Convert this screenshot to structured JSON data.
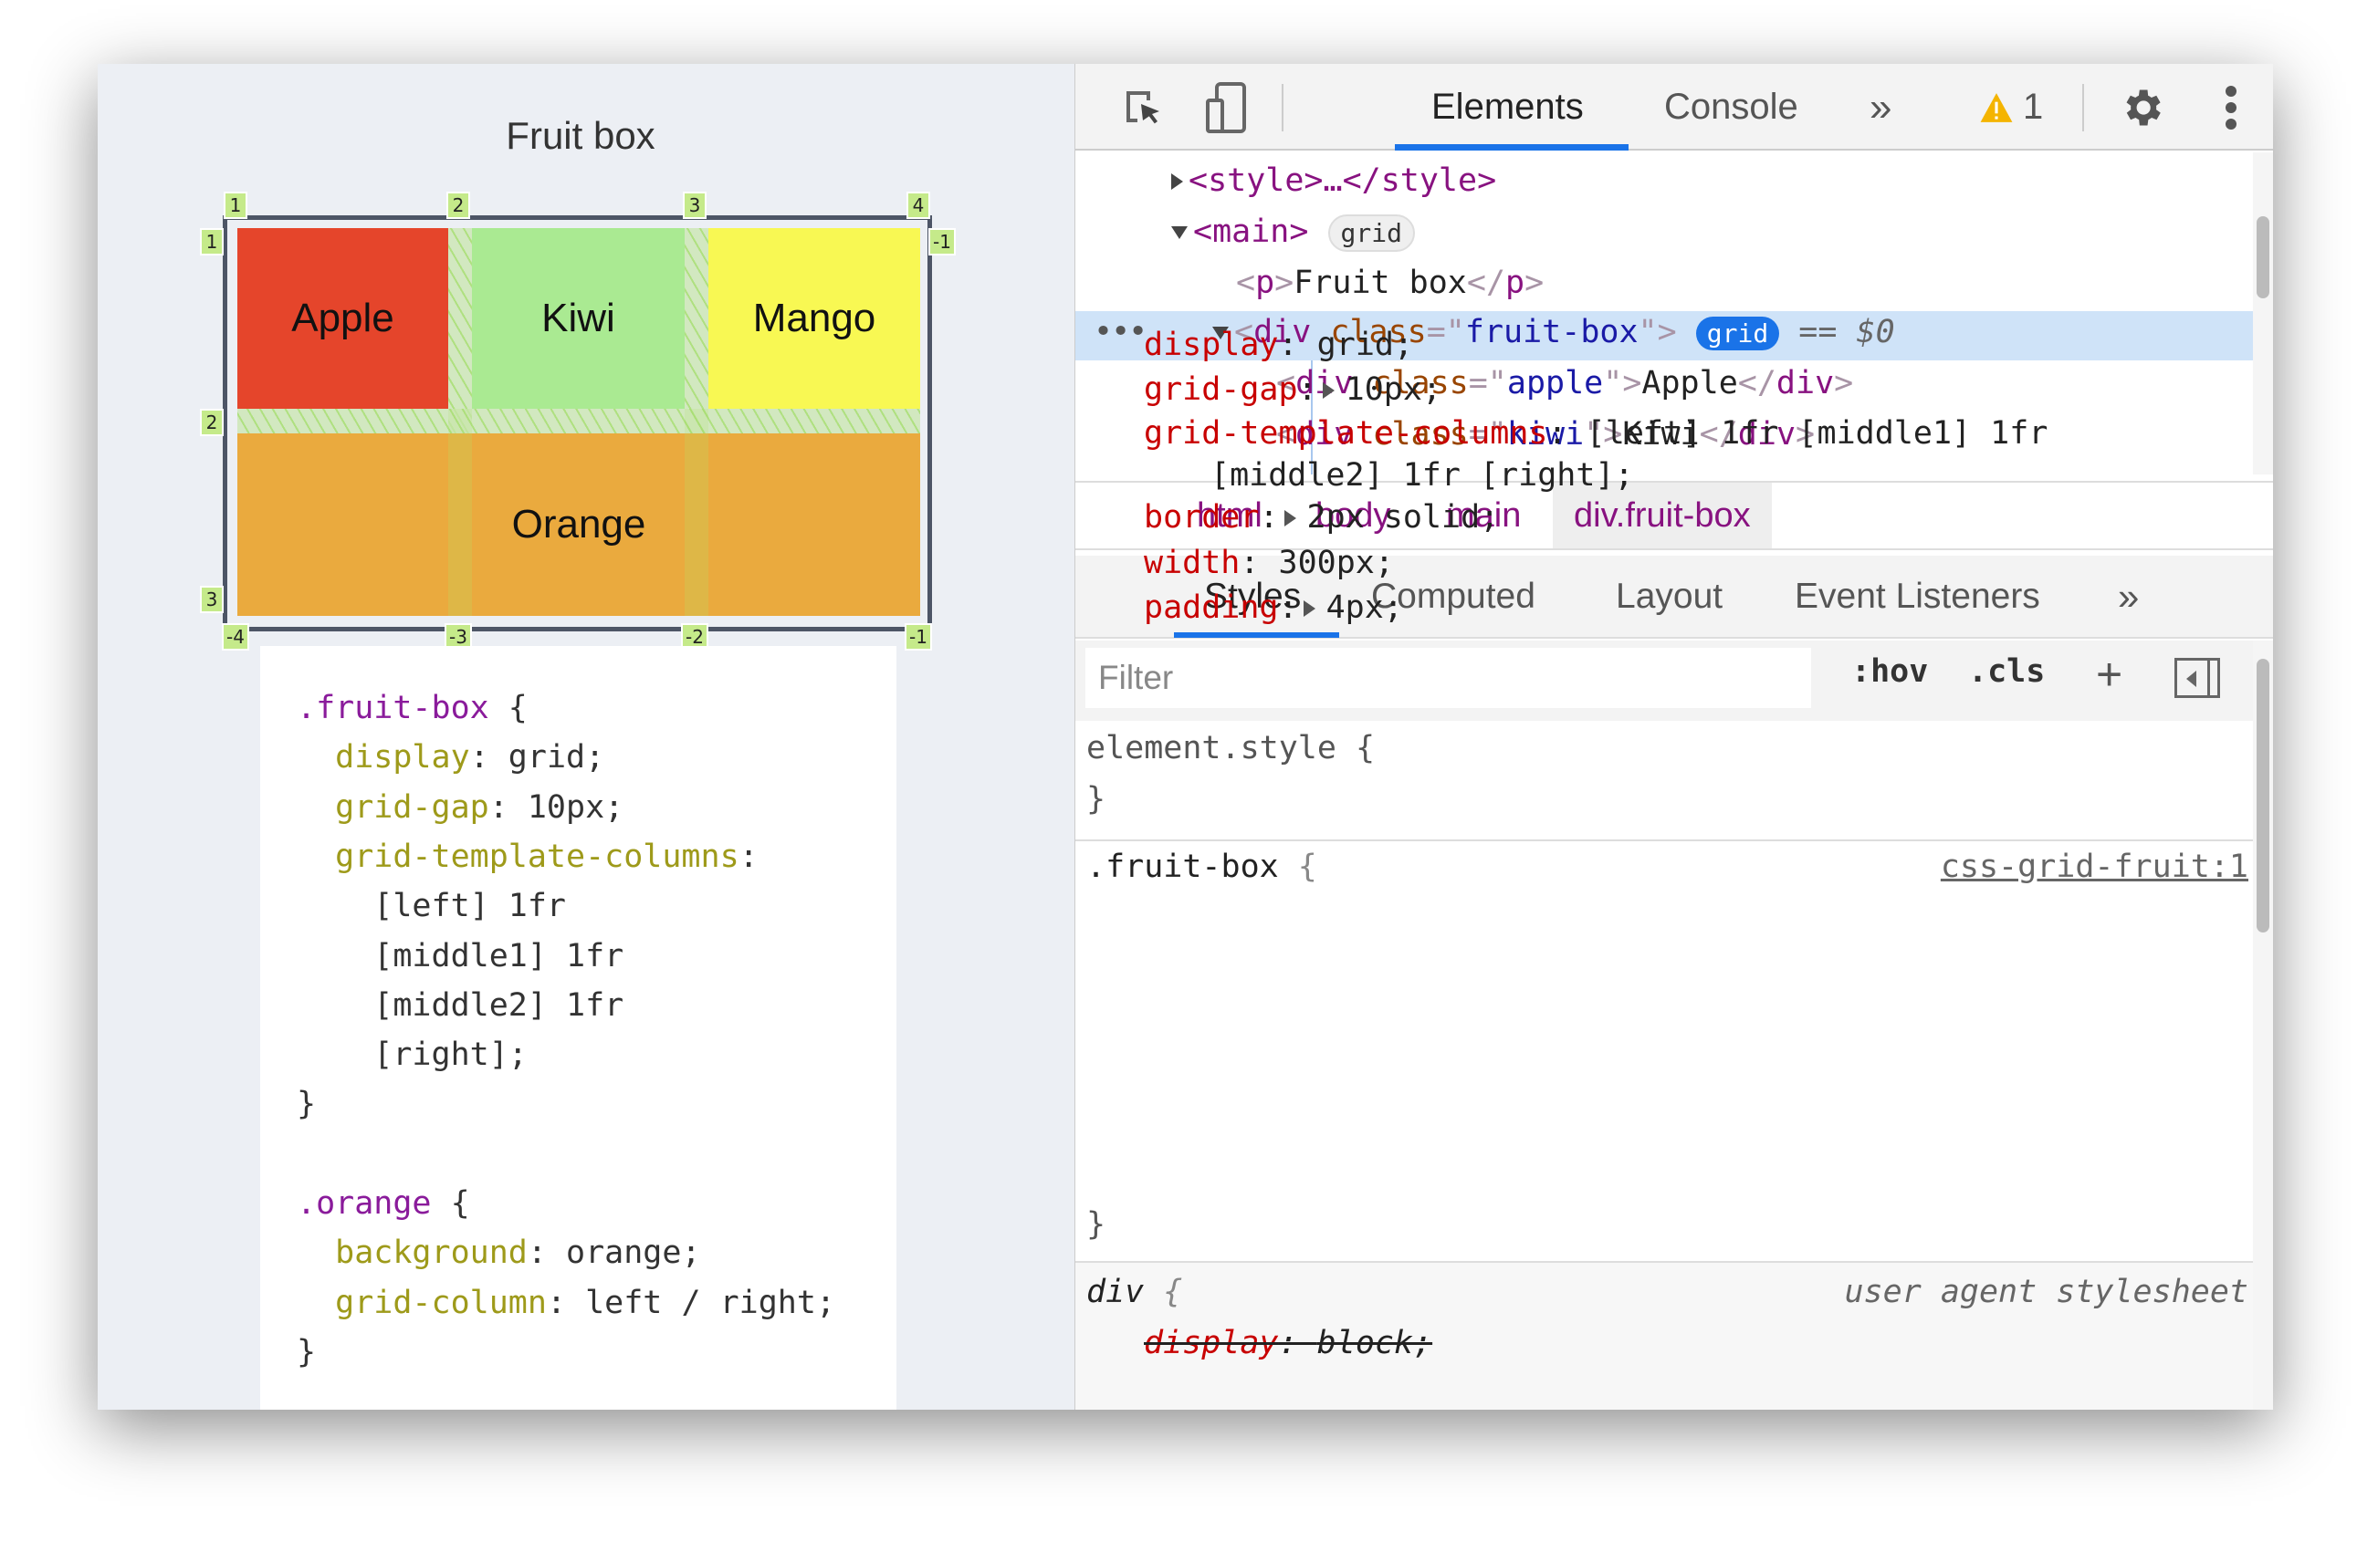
{
  "page": {
    "title": "Fruit box",
    "grid_items": [
      {
        "label": "Apple",
        "color": "#e5452b"
      },
      {
        "label": "Kiwi",
        "color": "#aaea92"
      },
      {
        "label": "Mango",
        "color": "#f8f853"
      },
      {
        "label": "Orange",
        "color": "#eaaa3e"
      }
    ],
    "grid_overlay": {
      "top": [
        "1",
        "2",
        "3",
        "4"
      ],
      "bottom": [
        "-4",
        "-3",
        "-2",
        "-1"
      ],
      "left": [
        "1",
        "2",
        "3"
      ],
      "right": [
        "-1"
      ],
      "color": "#c5ea8a"
    },
    "code": [
      {
        "parts": [
          [
            ".fruit-box",
            "sel"
          ],
          [
            " {",
            ""
          ]
        ]
      },
      {
        "parts": [
          [
            "  display",
            "prop"
          ],
          [
            ": grid;",
            ""
          ]
        ]
      },
      {
        "parts": [
          [
            "  grid-gap",
            "prop"
          ],
          [
            ": 10px;",
            ""
          ]
        ]
      },
      {
        "parts": [
          [
            "  grid-template-columns",
            "prop"
          ],
          [
            ":",
            ""
          ]
        ]
      },
      {
        "parts": [
          [
            "    [left] 1fr",
            ""
          ]
        ]
      },
      {
        "parts": [
          [
            "    [middle1] 1fr",
            ""
          ]
        ]
      },
      {
        "parts": [
          [
            "    [middle2] 1fr",
            ""
          ]
        ]
      },
      {
        "parts": [
          [
            "    [right];",
            ""
          ]
        ]
      },
      {
        "parts": [
          [
            "}",
            ""
          ]
        ]
      },
      {
        "parts": [
          [
            "",
            ""
          ]
        ]
      },
      {
        "parts": [
          [
            ".orange",
            "sel"
          ],
          [
            " {",
            ""
          ]
        ]
      },
      {
        "parts": [
          [
            "  background",
            "prop"
          ],
          [
            ": orange;",
            ""
          ]
        ]
      },
      {
        "parts": [
          [
            "  grid-column",
            "prop"
          ],
          [
            ": left / right;",
            ""
          ]
        ]
      },
      {
        "parts": [
          [
            "}",
            ""
          ]
        ]
      }
    ]
  },
  "devtools": {
    "toolbar": {
      "inspect_icon": "inspect-element-icon",
      "device_icon": "device-toolbar-icon",
      "tabs": [
        "Elements",
        "Console"
      ],
      "active_tab": "Elements",
      "more": "»",
      "warning_count": "1",
      "accent": "#1a73e8"
    },
    "dom": {
      "style": "<style>…</style>",
      "main_tag": "<main>",
      "main_badge": "grid",
      "p_line": "Fruit box",
      "selected": {
        "tag": "div",
        "attr": "class",
        "value": "fruit-box",
        "badge": "grid",
        "suffix": "== $0"
      },
      "children": [
        {
          "value": "apple",
          "text": "Apple"
        },
        {
          "value": "kiwi",
          "text": "Kiwi"
        }
      ]
    },
    "breadcrumb": [
      "html",
      "body",
      "main",
      "div.fruit-box"
    ],
    "panel_tabs": [
      "Styles",
      "Computed",
      "Layout",
      "Event Listeners"
    ],
    "panel_more": "»",
    "filter": {
      "placeholder": "Filter",
      "hov": ":hov",
      "cls": ".cls"
    },
    "styles": {
      "element_style": "element.style {",
      "rule_selector": ".fruit-box",
      "rule_source": "css-grid-fruit:1",
      "props": [
        {
          "name": "display",
          "value": "grid;",
          "expand": false
        },
        {
          "name": "grid-gap",
          "value": "10px;",
          "expand": true
        },
        {
          "name": "grid-template-columns",
          "value": "[left] 1fr [middle1] 1fr",
          "expand": false,
          "cont": "[middle2] 1fr [right];"
        },
        {
          "name": "border",
          "value": "2px solid;",
          "expand": true
        },
        {
          "name": "width",
          "value": "300px;",
          "expand": false
        },
        {
          "name": "padding",
          "value": "4px;",
          "expand": true
        }
      ],
      "ua_selector": "div",
      "ua_source": "user agent stylesheet",
      "ua_prop": "display",
      "ua_value": "block;"
    }
  }
}
